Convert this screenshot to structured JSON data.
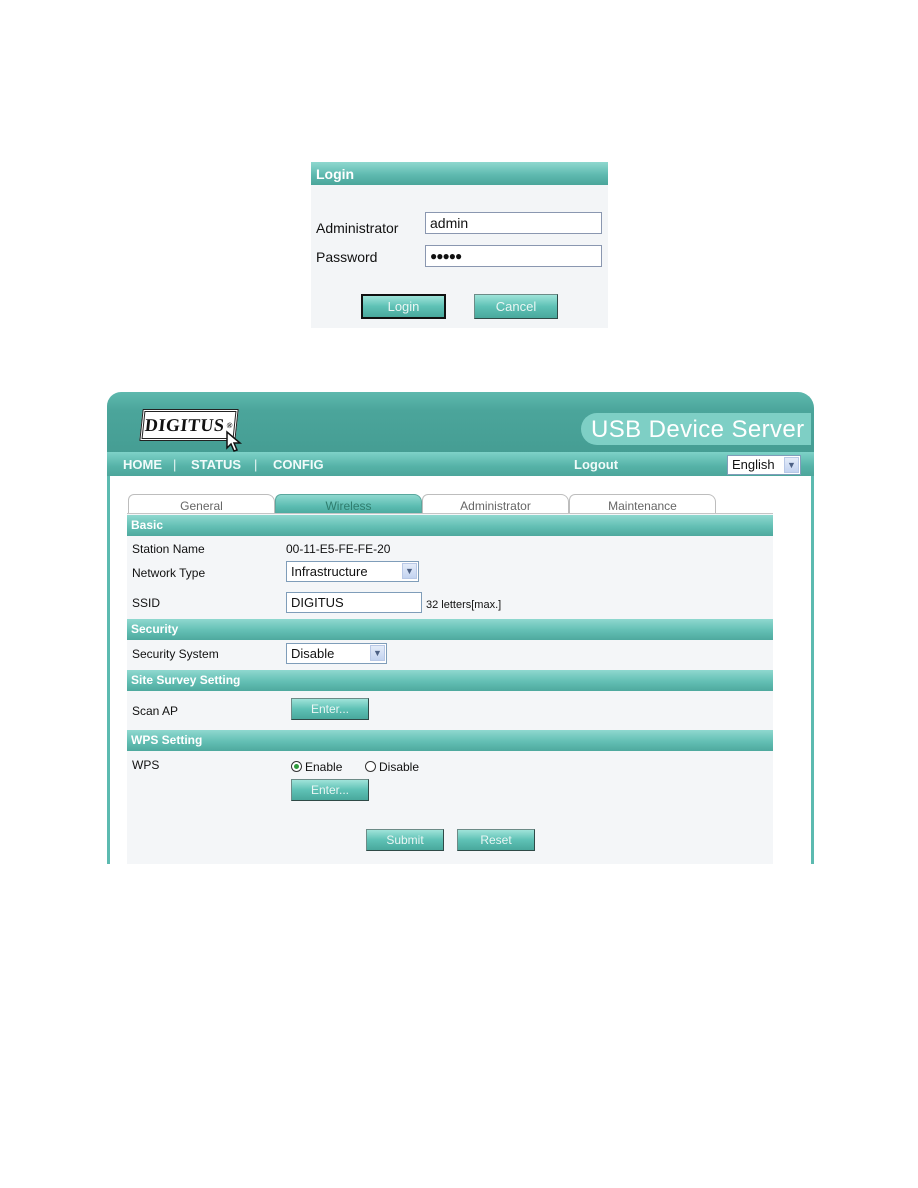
{
  "login": {
    "title": "Login",
    "administrator_label": "Administrator",
    "administrator_value": "admin",
    "password_label": "Password",
    "password_value": "●●●●●",
    "login_button": "Login",
    "cancel_button": "Cancel"
  },
  "header": {
    "logo_text": "DIGITUS",
    "logo_reg": "®",
    "product_title": "USB Device Server",
    "nav": [
      {
        "label": "HOME"
      },
      {
        "label": "STATUS"
      },
      {
        "label": "CONFIG"
      }
    ],
    "nav_separator": "|",
    "logout": "Logout",
    "language": "English"
  },
  "tabs": [
    {
      "label": "General",
      "active": false
    },
    {
      "label": "Wireless",
      "active": true
    },
    {
      "label": "Administrator",
      "active": false
    },
    {
      "label": "Maintenance",
      "active": false
    }
  ],
  "sections": {
    "basic": {
      "title": "Basic",
      "station_name_label": "Station Name",
      "station_name_value": "00-11-E5-FE-FE-20",
      "network_type_label": "Network Type",
      "network_type_value": "Infrastructure",
      "ssid_label": "SSID",
      "ssid_value": "DIGITUS",
      "ssid_hint": "32 letters[max.]"
    },
    "security": {
      "title": "Security",
      "security_system_label": "Security System",
      "security_system_value": "Disable"
    },
    "site_survey": {
      "title": "Site Survey Setting",
      "scan_ap_label": "Scan AP",
      "enter_button": "Enter..."
    },
    "wps": {
      "title": "WPS Setting",
      "wps_label": "WPS",
      "enable_label": "Enable",
      "disable_label": "Disable",
      "selected": "Enable",
      "enter_button": "Enter..."
    }
  },
  "actions": {
    "submit": "Submit",
    "reset": "Reset"
  },
  "colors": {
    "accent": "#5cbab0",
    "header_dark": "#459d93",
    "section_header": "#63bfb4"
  }
}
